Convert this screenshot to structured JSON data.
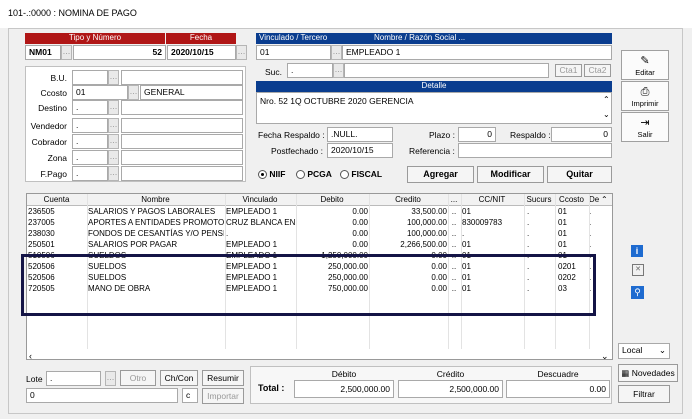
{
  "window": {
    "title": "101-.:0000 : NOMINA DE PAGO"
  },
  "doc": {
    "tipo_label": "Tipo y Número",
    "fecha_label": "Fecha",
    "tipo": "NM01",
    "numero": "52",
    "fecha": "2020/10/15"
  },
  "tercero": {
    "vinculado_label": "Vinculado / Tercero",
    "nombre_label": "Nombre / Razón Social ...",
    "vinculado": "01",
    "nombre": "EMPLEADO 1",
    "suc_label": "Suc.",
    "suc": ".",
    "cta1": "Cta1",
    "cta2": "Cta2"
  },
  "left_form": {
    "bu_label": "B.U.",
    "bu": "",
    "ccosto_label": "Ccosto",
    "ccosto": "01",
    "ccosto_name": "GENERAL",
    "destino_label": "Destino",
    "destino": ".",
    "vendedor_label": "Vendedor",
    "vendedor": ".",
    "cobrador_label": "Cobrador",
    "cobrador": ".",
    "zona_label": "Zona",
    "zona": ".",
    "fpago_label": "F.Pago",
    "fpago": "."
  },
  "detalle": {
    "label": "Detalle",
    "text": "Nro. 52 1Q OCTUBRE 2020 GERENCIA"
  },
  "extra": {
    "fecha_respaldo_label": "Fecha Respaldo :",
    "fecha_respaldo": ".NULL.",
    "plazo_label": "Plazo :",
    "plazo": "0",
    "respaldo_label": "Respaldo :",
    "respaldo": "0",
    "postfechado_label": "Postfechado :",
    "postfechado": "2020/10/15",
    "referencia_label": "Referencia :",
    "referencia": ""
  },
  "modes": {
    "niif": "NIIF",
    "pcga": "PCGA",
    "fiscal": "FISCAL",
    "selected": "NIIF"
  },
  "actions": {
    "agregar": "Agregar",
    "modificar": "Modificar",
    "quitar": "Quitar"
  },
  "side": {
    "editar": "Editar",
    "imprimir": "Imprimir",
    "salir": "Salir"
  },
  "grid": {
    "headers": [
      "Cuenta",
      "Nombre",
      "Vinculado",
      "Debito",
      "Credito",
      "...",
      "CC/NIT",
      "Sucurs",
      "Ccosto",
      "De"
    ],
    "rows": [
      [
        "236505",
        "SALARIOS Y PAGOS LABORALES",
        "EMPLEADO 1",
        "0.00",
        "33,500.00",
        "..",
        "01",
        ".",
        "01",
        "."
      ],
      [
        "237005",
        "APORTES A ENTIDADES PROMOTO",
        "CRUZ BLANCA EN",
        "0.00",
        "100,000.00",
        "..",
        "830009783",
        ".",
        "01",
        "."
      ],
      [
        "238030",
        "FONDOS DE CESANTÍAS Y/O PENSI",
        ".",
        "0.00",
        "100,000.00",
        "..",
        ".",
        ".",
        "01",
        "."
      ],
      [
        "250501",
        "SALARIOS POR PAGAR",
        "EMPLEADO 1",
        "0.00",
        "2,266,500.00",
        "..",
        "01",
        ".",
        "01",
        "."
      ],
      [
        "510506",
        "SUELDOS",
        "EMPLEADO 1",
        "1,250,000.00",
        "0.00",
        "..",
        "01",
        ".",
        "01",
        "."
      ],
      [
        "520506",
        "SUELDOS",
        "EMPLEADO 1",
        "250,000.00",
        "0.00",
        "..",
        "01",
        ".",
        "0201",
        "."
      ],
      [
        "520506",
        "SUELDOS",
        "EMPLEADO 1",
        "250,000.00",
        "0.00",
        "..",
        "01",
        ".",
        "0202",
        "."
      ],
      [
        "720505",
        "MANO DE OBRA",
        "EMPLEADO 1",
        "750,000.00",
        "0.00",
        "..",
        "01",
        ".",
        "03",
        "."
      ]
    ]
  },
  "bottom": {
    "lote_label": "Lote",
    "lote": ".",
    "lote_num": "0",
    "otro": "Otro",
    "chcon": "Ch/Con",
    "resumir": "Resumir",
    "importar": "Importar",
    "c_label": "c",
    "total_label": "Total :",
    "debito_label": "Débito",
    "credito_label": "Crédito",
    "descuadre_label": "Descuadre",
    "debito": "2,500,000.00",
    "credito": "2,500,000.00",
    "descuadre": "0.00"
  },
  "right_bottom": {
    "local": "Local",
    "novedades": "Novedades",
    "filtrar": "Filtrar"
  }
}
